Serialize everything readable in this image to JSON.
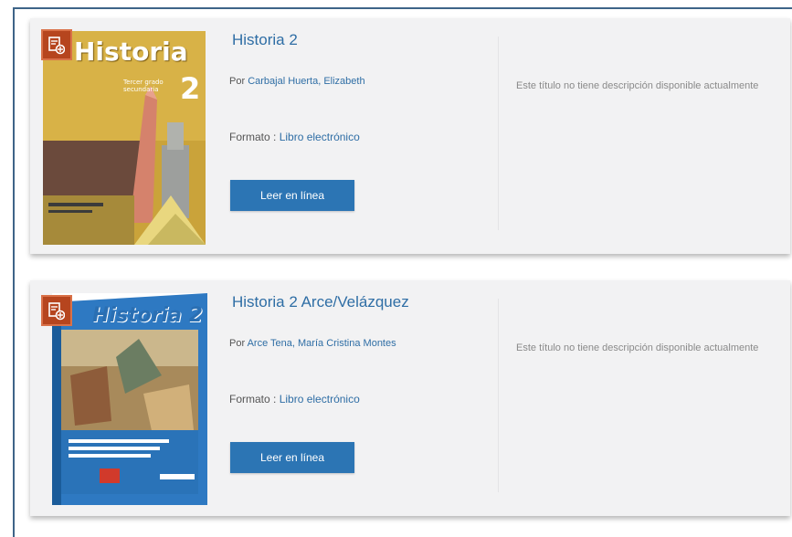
{
  "results": [
    {
      "title": "Historia 2",
      "author_prefix": "Por",
      "author": "Carbajal Huerta, Elizabeth",
      "format_label": "Formato :",
      "format_value": "Libro electrónico",
      "read_button": "Leer en línea",
      "description": "Este título no tiene descripción disponible actualmente",
      "badge_icon": "ebook-icon",
      "cover": {
        "title": "Historia",
        "number": "2",
        "subtitle": "Tercer grado secundaria",
        "accent": "#c99a21"
      }
    },
    {
      "title": "Historia 2 Arce/Velázquez",
      "author_prefix": "Por",
      "author": "Arce Tena, María Cristina Montes",
      "format_label": "Formato :",
      "format_value": "Libro electrónico",
      "read_button": "Leer en línea",
      "description": "Este título no tiene descripción disponible actualmente",
      "badge_icon": "ebook-icon",
      "cover": {
        "title": "Historia 2",
        "accent": "#2f7ac0"
      }
    }
  ]
}
